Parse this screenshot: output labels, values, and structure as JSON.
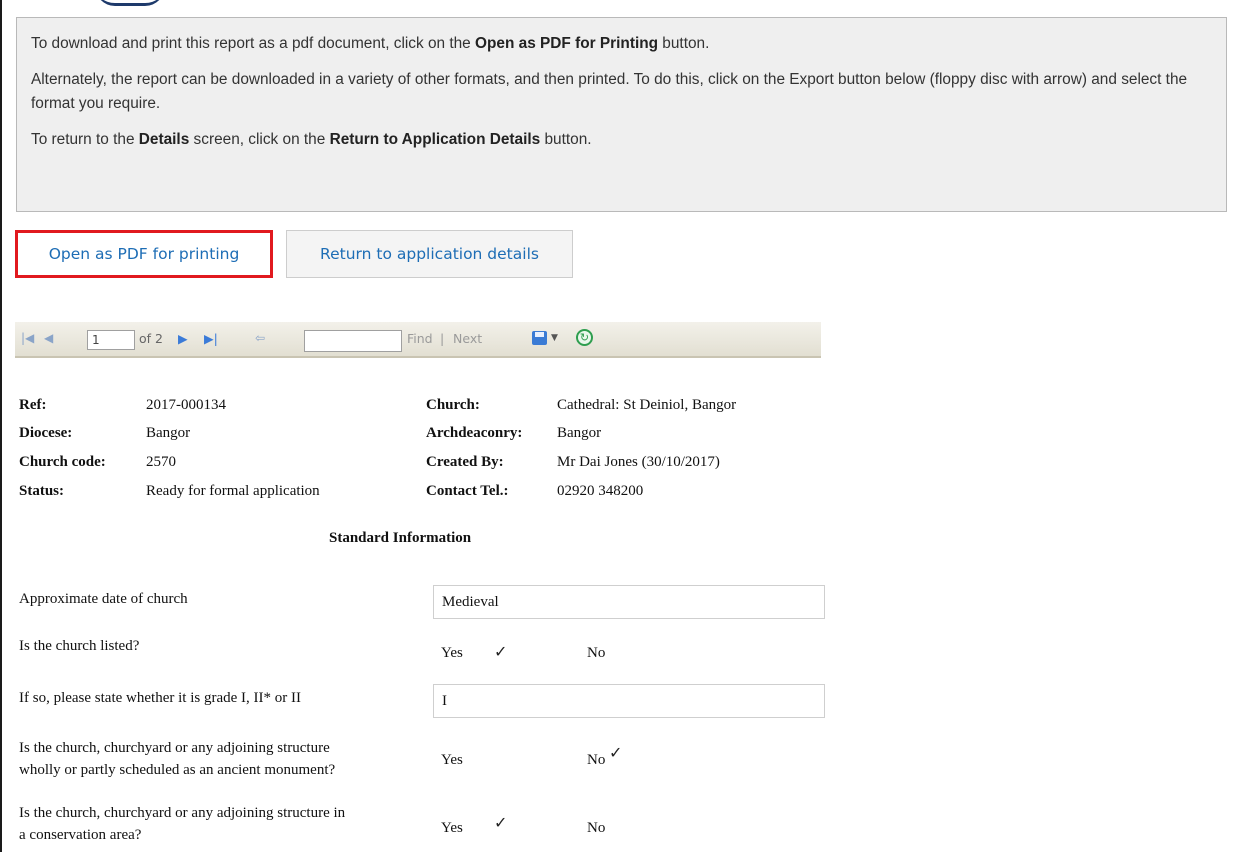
{
  "info": {
    "p1_a": "To download and print this report as a pdf document, click on the ",
    "p1_b": "Open as PDF for Printing",
    "p1_c": " button.",
    "p2": "Alternately, the report can be downloaded in a variety of other formats, and then printed. To do this, click on the Export button below (floppy disc with arrow) and select the format you require.",
    "p3_a": "To return to the ",
    "p3_b": "Details",
    "p3_c": " screen, click on the ",
    "p3_d": "Return to Application Details",
    "p3_e": " button."
  },
  "buttons": {
    "pdf": "Open as PDF for printing",
    "return": "Return to application details"
  },
  "toolbar": {
    "page_value": "1",
    "page_of": "of 2",
    "find_label": "Find",
    "separator": "|",
    "next_label": "Next",
    "first_icon": "first-page-icon",
    "prev_icon": "previous-page-icon",
    "next_icon": "next-page-icon",
    "last_icon": "last-page-icon",
    "back_icon": "back-icon",
    "export_icon": "export-floppy-icon",
    "refresh_icon": "refresh-icon"
  },
  "report": {
    "ref_label": "Ref:",
    "ref_value": "2017-000134",
    "diocese_label": "Diocese:",
    "diocese_value": "Bangor",
    "code_label": "Church code:",
    "code_value": "2570",
    "status_label": "Status:",
    "status_value": "Ready for formal application",
    "church_label": "Church:",
    "church_value": "Cathedral: St Deiniol, Bangor",
    "archdeaconry_label": "Archdeaconry:",
    "archdeaconry_value": "Bangor",
    "created_label": "Created By:",
    "created_value": "Mr Dai Jones (30/10/2017)",
    "tel_label": "Contact Tel.:",
    "tel_value": "02920 348200",
    "section_title": "Standard Information"
  },
  "questions": {
    "q1": "Approximate date of church",
    "a1": "Medieval",
    "q2": "Is the church listed?",
    "q3": "If so, please state whether it is grade I, II* or II",
    "a3": "I",
    "q4_l1": "Is the church, churchyard or any adjoining structure",
    "q4_l2": "wholly or partly scheduled as an ancient monument?",
    "q5_l1": "Is the church, churchyard or any adjoining structure in",
    "q5_l2": "a conservation area?",
    "yes": "Yes",
    "no": "No",
    "tick": "✓"
  }
}
